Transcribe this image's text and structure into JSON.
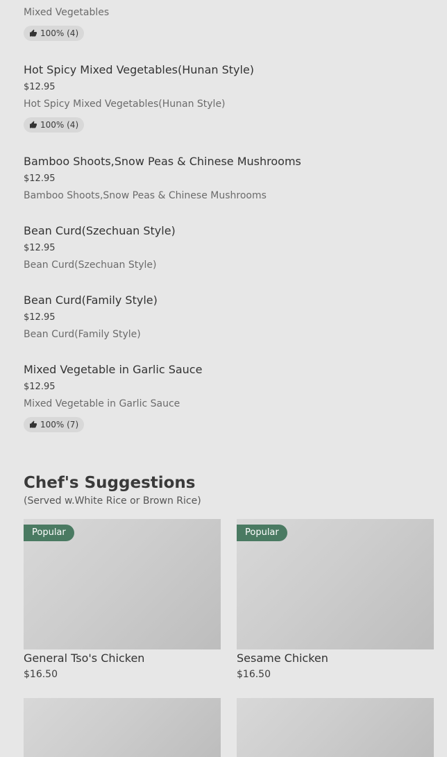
{
  "menu_items": [
    {
      "name": "",
      "price": "",
      "description": "Mixed Vegetables",
      "rating": "100% (4)"
    },
    {
      "name": "Hot Spicy Mixed Vegetables(Hunan Style)",
      "price": "$12.95",
      "description": "Hot Spicy Mixed Vegetables(Hunan Style)",
      "rating": "100% (4)"
    },
    {
      "name": "Bamboo Shoots,Snow Peas & Chinese Mushrooms",
      "price": "$12.95",
      "description": "Bamboo Shoots,Snow Peas & Chinese Mushrooms",
      "rating": ""
    },
    {
      "name": "Bean Curd(Szechuan Style)",
      "price": "$12.95",
      "description": "Bean Curd(Szechuan Style)",
      "rating": ""
    },
    {
      "name": "Bean Curd(Family Style)",
      "price": "$12.95",
      "description": "Bean Curd(Family Style)",
      "rating": ""
    },
    {
      "name": "Mixed Vegetable in Garlic Sauce",
      "price": "$12.95",
      "description": "Mixed Vegetable in Garlic Sauce",
      "rating": "100% (7)"
    }
  ],
  "chefs_suggestions": {
    "title": "Chef's Suggestions",
    "subtitle": "(Served w.White Rice or Brown Rice)",
    "cards": [
      {
        "badge": "Popular",
        "name": "General Tso's Chicken",
        "price": "$16.50"
      },
      {
        "badge": "Popular",
        "name": "Sesame Chicken",
        "price": "$16.50"
      }
    ]
  },
  "icons": {
    "thumbs_up": "thumbs-up-icon"
  },
  "colors": {
    "background": "#e7e7e7",
    "badge": "#4a7a62",
    "rating_chip": "#d8d8d8"
  }
}
